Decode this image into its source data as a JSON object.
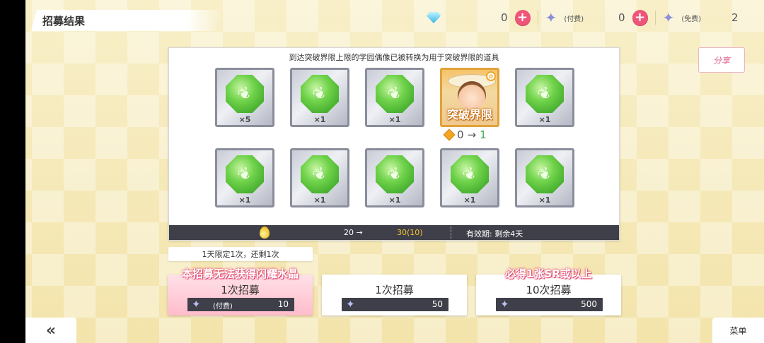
{
  "header": {
    "title": "招募结果",
    "gem_icon": "diamond-icon",
    "paid_star_count": "0",
    "paid_tag": "(付费)",
    "free_star_count": "0",
    "free_tag": "(免费)",
    "extra_count": "2"
  },
  "share": {
    "label": "分享"
  },
  "panel": {
    "message": "到达突破界限上限的学园偶像已被转换为用于突破界限的道具",
    "cards_row1": [
      {
        "count": "×5"
      },
      {
        "count": "×1"
      },
      {
        "count": "×1"
      },
      {
        "idol_label": "突破界限"
      },
      {
        "count": "×1"
      }
    ],
    "cards_row2": [
      {
        "count": "×1"
      },
      {
        "count": "×1"
      },
      {
        "count": "×1"
      },
      {
        "count": "×1"
      },
      {
        "count": "×1"
      }
    ],
    "limit_from": "0",
    "limit_arrow": "→",
    "limit_to": "1",
    "bar": {
      "from": "20 →",
      "to": "30(10)",
      "expiry": "有效期: 剩余4天"
    }
  },
  "daily_limit": "1天限定1次，还剩1次",
  "scouts": [
    {
      "ribbon": "本招募无法获得闪耀水晶",
      "title": "1次招募",
      "paid_tag": "(付费)",
      "cost": "10"
    },
    {
      "ribbon": "",
      "title": "1次招募",
      "paid_tag": "",
      "cost": "50"
    },
    {
      "ribbon": "必得1张SR或以上",
      "title": "10次招募",
      "paid_tag": "",
      "cost": "500"
    }
  ],
  "footer": {
    "back": "«",
    "menu": "菜单"
  },
  "colors": {
    "accent_pink": "#ee5579",
    "bar_dark": "#3f3f4a",
    "gold": "#f3c530",
    "green": "#3aa84d"
  }
}
